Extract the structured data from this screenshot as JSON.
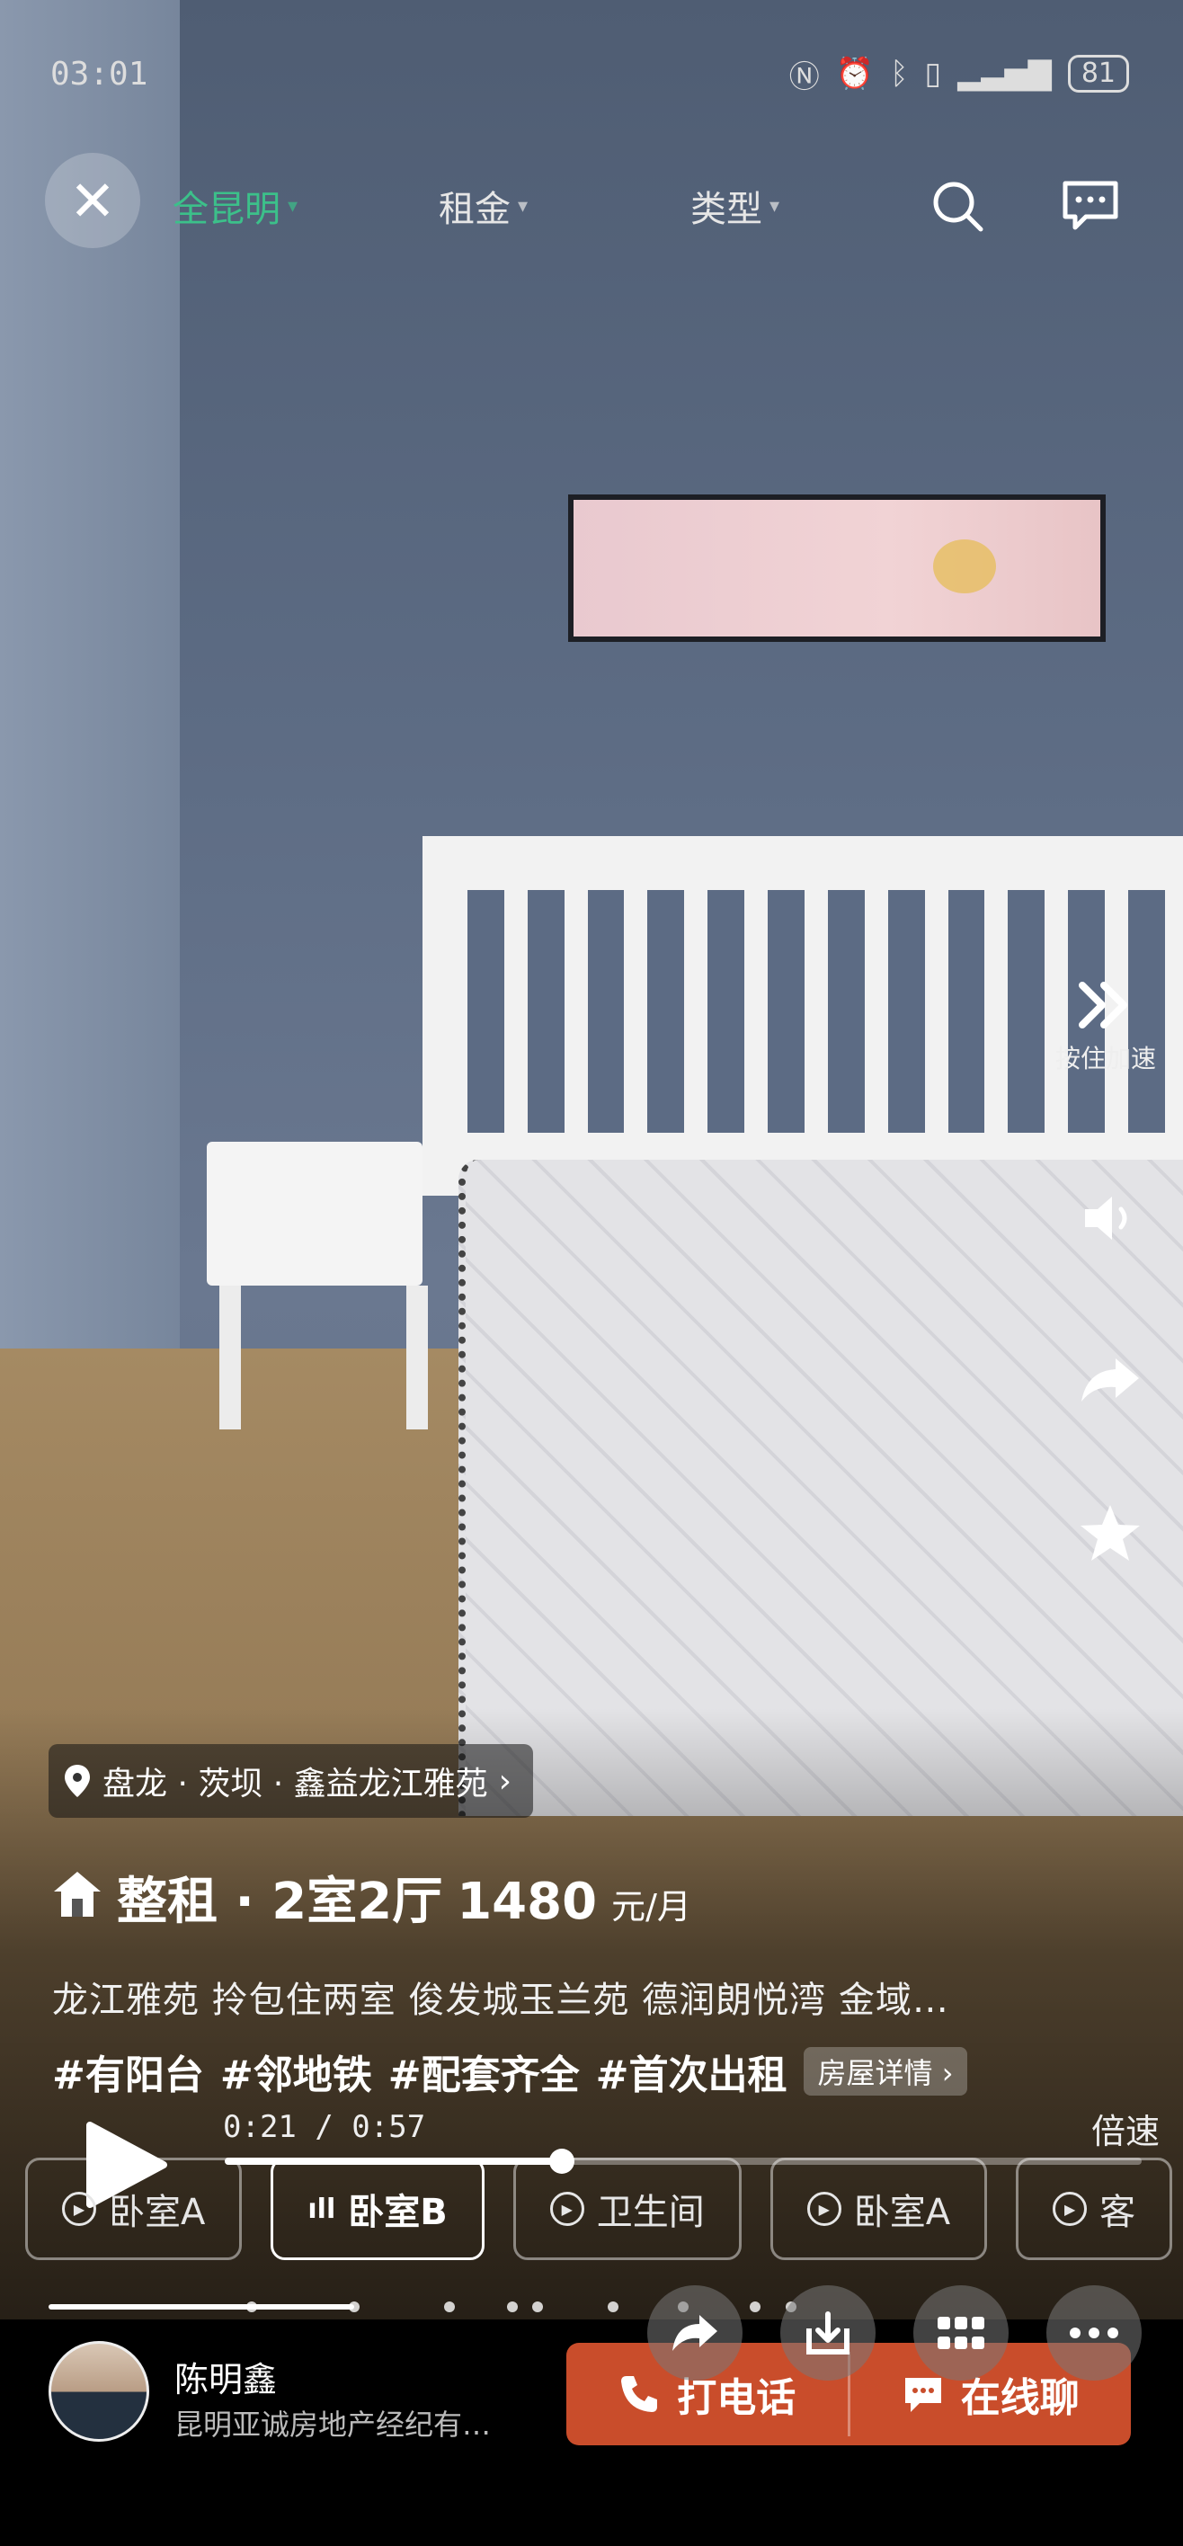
{
  "status_bar": {
    "time": "03:01",
    "battery": "81"
  },
  "nav": {
    "items": [
      {
        "label": "全昆明",
        "selected": true
      },
      {
        "label": "租金",
        "selected": false
      },
      {
        "label": "类型",
        "selected": false
      }
    ],
    "accent_color": "#3cc08a"
  },
  "side": {
    "speed_label": "按住加速"
  },
  "listing": {
    "location": "盘龙 · 茨坝 · 鑫益龙江雅苑",
    "title": "整租 · 2室2厅",
    "price": "1480",
    "price_unit": "元/月",
    "description": "龙江雅苑 拎包住两室 俊发城玉兰苑 德润朗悦湾 金域…",
    "tags": [
      "#有阳台",
      "#邻地铁",
      "#配套齐全",
      "#首次出租"
    ],
    "detail_label": "房屋详情"
  },
  "player": {
    "timecode": "0:21 / 0:57",
    "speed_label": "倍速",
    "progress": 0.368
  },
  "chapters": [
    {
      "label": "卧室A",
      "active": false
    },
    {
      "label": "卧室B",
      "active": true
    },
    {
      "label": "卫生间",
      "active": false
    },
    {
      "label": "卧室A",
      "active": false
    },
    {
      "label": "客",
      "active": false
    }
  ],
  "agent": {
    "name": "陈明鑫",
    "company": "昆明亚诚房地产经纪有…",
    "call_label": "打电话",
    "chat_label": "在线聊",
    "button_color": "#c94d2b"
  }
}
